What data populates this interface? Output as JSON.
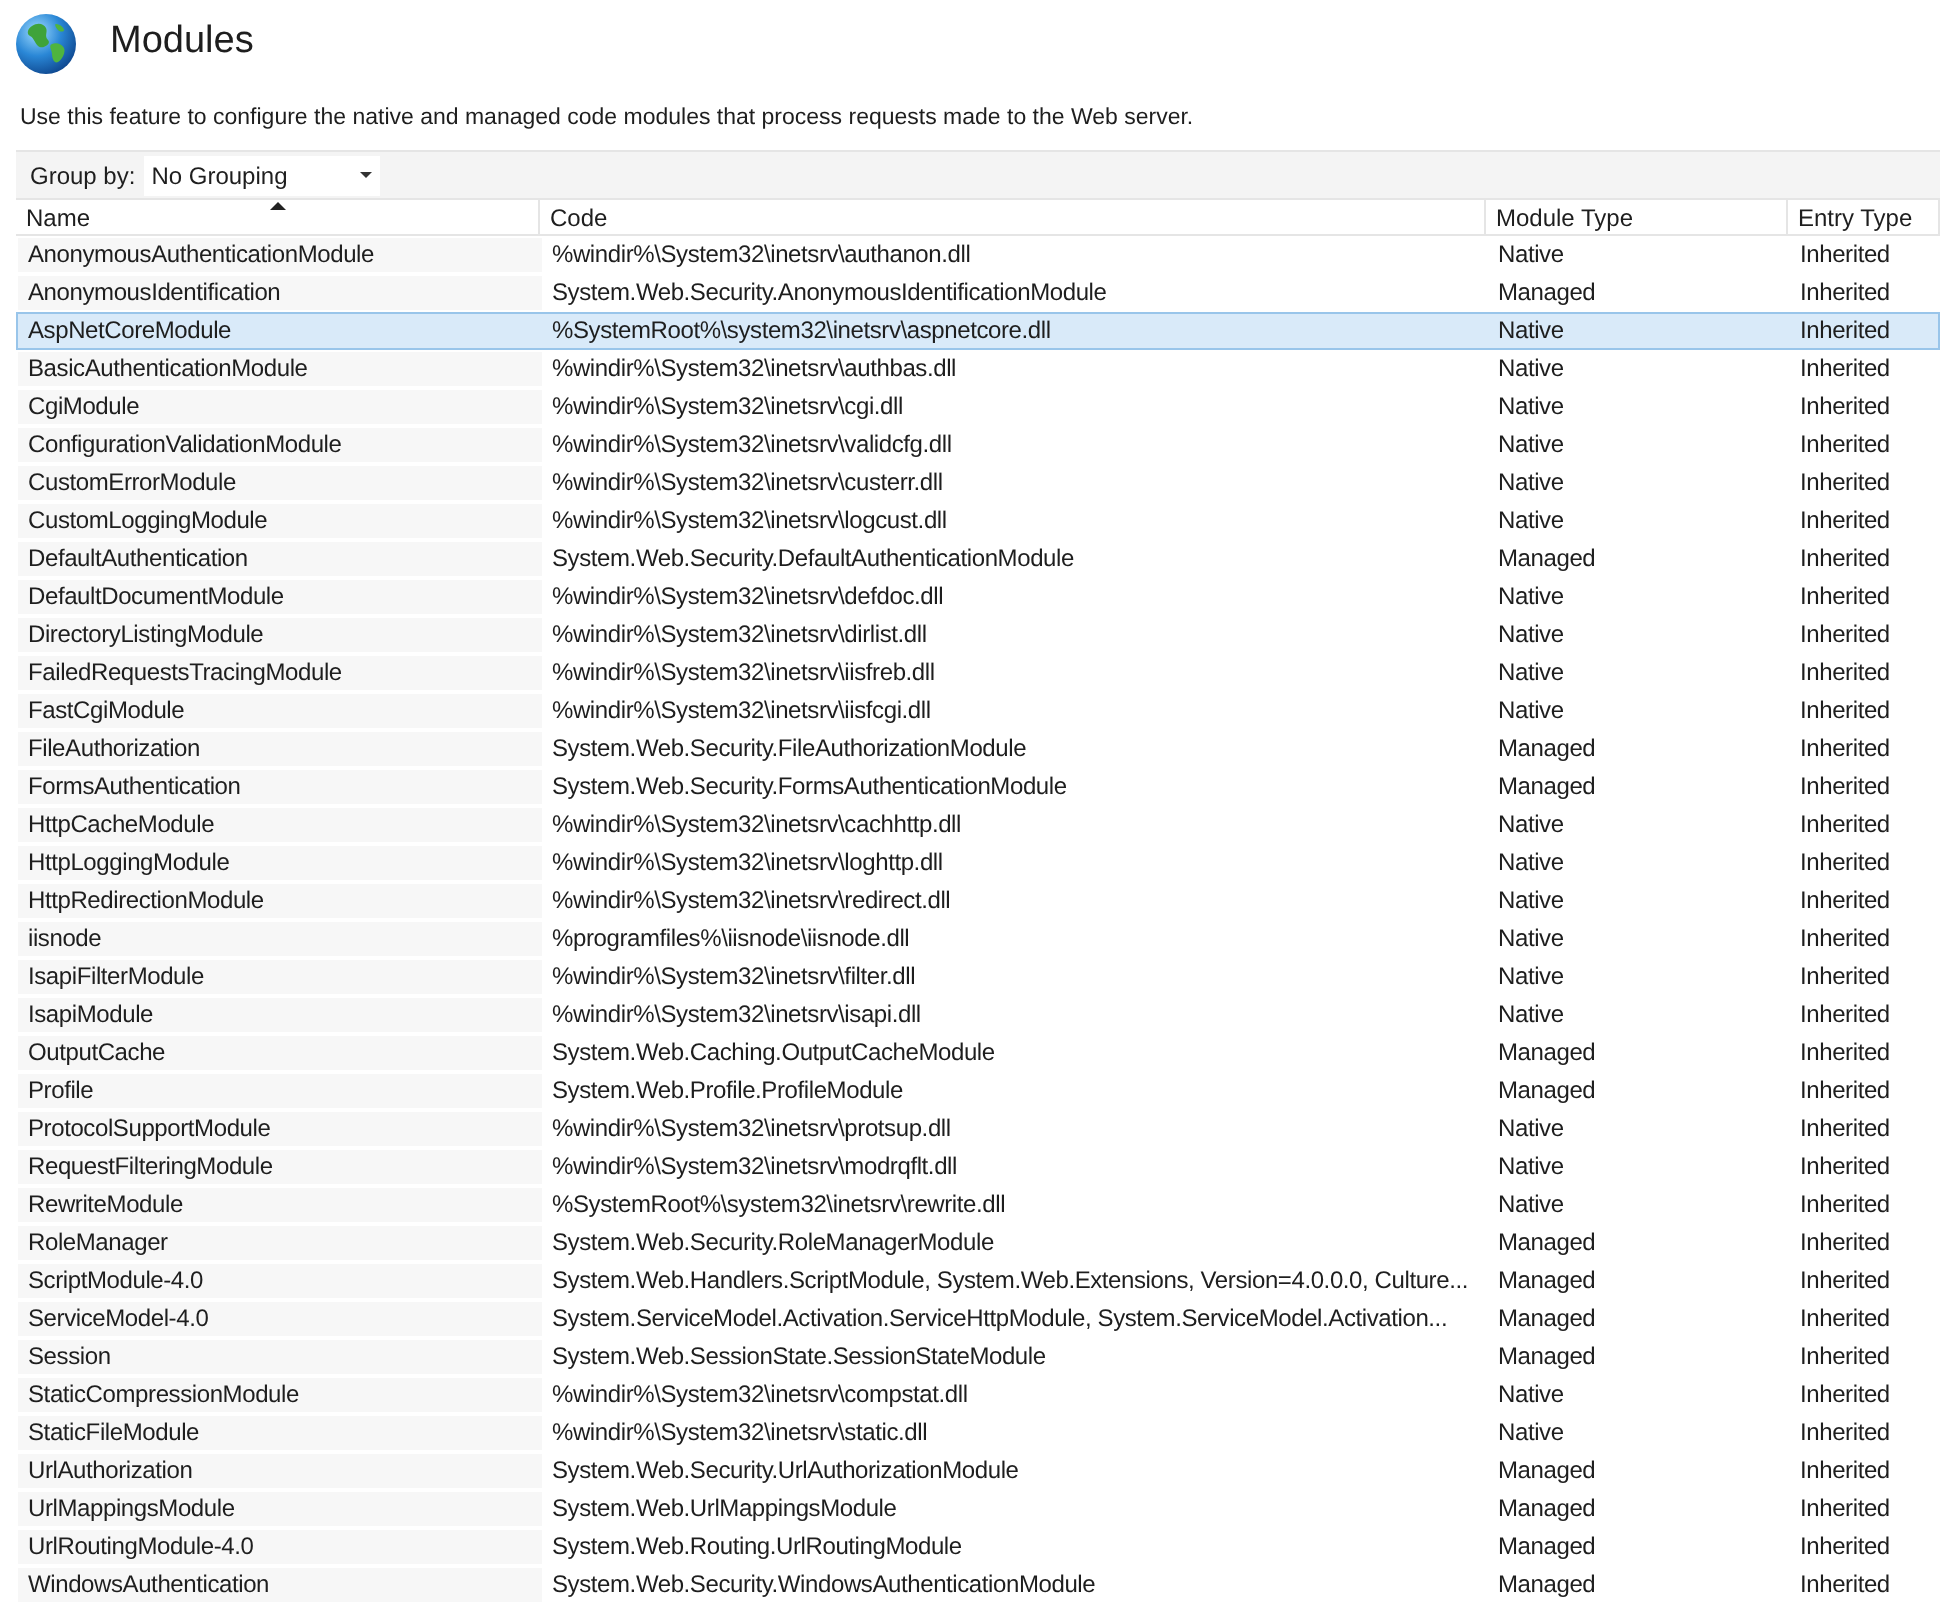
{
  "title": "Modules",
  "description": "Use this feature to configure the native and managed code modules that process requests made to the Web server.",
  "group_by": {
    "label": "Group by:",
    "value": "No Grouping"
  },
  "table": {
    "columns": [
      {
        "label": "Name",
        "sorted": true
      },
      {
        "label": "Code",
        "sorted": false
      },
      {
        "label": "Module Type",
        "sorted": false
      },
      {
        "label": "Entry Type",
        "sorted": false
      }
    ],
    "rows": [
      {
        "name": "AnonymousAuthenticationModule",
        "code": "%windir%\\System32\\inetsrv\\authanon.dll",
        "module_type": "Native",
        "entry_type": "Inherited",
        "selected": false
      },
      {
        "name": "AnonymousIdentification",
        "code": "System.Web.Security.AnonymousIdentificationModule",
        "module_type": "Managed",
        "entry_type": "Inherited",
        "selected": false
      },
      {
        "name": "AspNetCoreModule",
        "code": "%SystemRoot%\\system32\\inetsrv\\aspnetcore.dll",
        "module_type": "Native",
        "entry_type": "Inherited",
        "selected": true
      },
      {
        "name": "BasicAuthenticationModule",
        "code": "%windir%\\System32\\inetsrv\\authbas.dll",
        "module_type": "Native",
        "entry_type": "Inherited",
        "selected": false
      },
      {
        "name": "CgiModule",
        "code": "%windir%\\System32\\inetsrv\\cgi.dll",
        "module_type": "Native",
        "entry_type": "Inherited",
        "selected": false
      },
      {
        "name": "ConfigurationValidationModule",
        "code": "%windir%\\System32\\inetsrv\\validcfg.dll",
        "module_type": "Native",
        "entry_type": "Inherited",
        "selected": false
      },
      {
        "name": "CustomErrorModule",
        "code": "%windir%\\System32\\inetsrv\\custerr.dll",
        "module_type": "Native",
        "entry_type": "Inherited",
        "selected": false
      },
      {
        "name": "CustomLoggingModule",
        "code": "%windir%\\System32\\inetsrv\\logcust.dll",
        "module_type": "Native",
        "entry_type": "Inherited",
        "selected": false
      },
      {
        "name": "DefaultAuthentication",
        "code": "System.Web.Security.DefaultAuthenticationModule",
        "module_type": "Managed",
        "entry_type": "Inherited",
        "selected": false
      },
      {
        "name": "DefaultDocumentModule",
        "code": "%windir%\\System32\\inetsrv\\defdoc.dll",
        "module_type": "Native",
        "entry_type": "Inherited",
        "selected": false
      },
      {
        "name": "DirectoryListingModule",
        "code": "%windir%\\System32\\inetsrv\\dirlist.dll",
        "module_type": "Native",
        "entry_type": "Inherited",
        "selected": false
      },
      {
        "name": "FailedRequestsTracingModule",
        "code": "%windir%\\System32\\inetsrv\\iisfreb.dll",
        "module_type": "Native",
        "entry_type": "Inherited",
        "selected": false
      },
      {
        "name": "FastCgiModule",
        "code": "%windir%\\System32\\inetsrv\\iisfcgi.dll",
        "module_type": "Native",
        "entry_type": "Inherited",
        "selected": false
      },
      {
        "name": "FileAuthorization",
        "code": "System.Web.Security.FileAuthorizationModule",
        "module_type": "Managed",
        "entry_type": "Inherited",
        "selected": false
      },
      {
        "name": "FormsAuthentication",
        "code": "System.Web.Security.FormsAuthenticationModule",
        "module_type": "Managed",
        "entry_type": "Inherited",
        "selected": false
      },
      {
        "name": "HttpCacheModule",
        "code": "%windir%\\System32\\inetsrv\\cachhttp.dll",
        "module_type": "Native",
        "entry_type": "Inherited",
        "selected": false
      },
      {
        "name": "HttpLoggingModule",
        "code": "%windir%\\System32\\inetsrv\\loghttp.dll",
        "module_type": "Native",
        "entry_type": "Inherited",
        "selected": false
      },
      {
        "name": "HttpRedirectionModule",
        "code": "%windir%\\System32\\inetsrv\\redirect.dll",
        "module_type": "Native",
        "entry_type": "Inherited",
        "selected": false
      },
      {
        "name": "iisnode",
        "code": "%programfiles%\\iisnode\\iisnode.dll",
        "module_type": "Native",
        "entry_type": "Inherited",
        "selected": false
      },
      {
        "name": "IsapiFilterModule",
        "code": "%windir%\\System32\\inetsrv\\filter.dll",
        "module_type": "Native",
        "entry_type": "Inherited",
        "selected": false
      },
      {
        "name": "IsapiModule",
        "code": "%windir%\\System32\\inetsrv\\isapi.dll",
        "module_type": "Native",
        "entry_type": "Inherited",
        "selected": false
      },
      {
        "name": "OutputCache",
        "code": "System.Web.Caching.OutputCacheModule",
        "module_type": "Managed",
        "entry_type": "Inherited",
        "selected": false
      },
      {
        "name": "Profile",
        "code": "System.Web.Profile.ProfileModule",
        "module_type": "Managed",
        "entry_type": "Inherited",
        "selected": false
      },
      {
        "name": "ProtocolSupportModule",
        "code": "%windir%\\System32\\inetsrv\\protsup.dll",
        "module_type": "Native",
        "entry_type": "Inherited",
        "selected": false
      },
      {
        "name": "RequestFilteringModule",
        "code": "%windir%\\System32\\inetsrv\\modrqflt.dll",
        "module_type": "Native",
        "entry_type": "Inherited",
        "selected": false
      },
      {
        "name": "RewriteModule",
        "code": "%SystemRoot%\\system32\\inetsrv\\rewrite.dll",
        "module_type": "Native",
        "entry_type": "Inherited",
        "selected": false
      },
      {
        "name": "RoleManager",
        "code": "System.Web.Security.RoleManagerModule",
        "module_type": "Managed",
        "entry_type": "Inherited",
        "selected": false
      },
      {
        "name": "ScriptModule-4.0",
        "code": "System.Web.Handlers.ScriptModule, System.Web.Extensions, Version=4.0.0.0, Culture...",
        "module_type": "Managed",
        "entry_type": "Inherited",
        "selected": false
      },
      {
        "name": "ServiceModel-4.0",
        "code": "System.ServiceModel.Activation.ServiceHttpModule, System.ServiceModel.Activation...",
        "module_type": "Managed",
        "entry_type": "Inherited",
        "selected": false
      },
      {
        "name": "Session",
        "code": "System.Web.SessionState.SessionStateModule",
        "module_type": "Managed",
        "entry_type": "Inherited",
        "selected": false
      },
      {
        "name": "StaticCompressionModule",
        "code": "%windir%\\System32\\inetsrv\\compstat.dll",
        "module_type": "Native",
        "entry_type": "Inherited",
        "selected": false
      },
      {
        "name": "StaticFileModule",
        "code": "%windir%\\System32\\inetsrv\\static.dll",
        "module_type": "Native",
        "entry_type": "Inherited",
        "selected": false
      },
      {
        "name": "UrlAuthorization",
        "code": "System.Web.Security.UrlAuthorizationModule",
        "module_type": "Managed",
        "entry_type": "Inherited",
        "selected": false
      },
      {
        "name": "UrlMappingsModule",
        "code": "System.Web.UrlMappingsModule",
        "module_type": "Managed",
        "entry_type": "Inherited",
        "selected": false
      },
      {
        "name": "UrlRoutingModule-4.0",
        "code": "System.Web.Routing.UrlRoutingModule",
        "module_type": "Managed",
        "entry_type": "Inherited",
        "selected": false
      },
      {
        "name": "WindowsAuthentication",
        "code": "System.Web.Security.WindowsAuthenticationModule",
        "module_type": "Managed",
        "entry_type": "Inherited",
        "selected": false
      }
    ]
  }
}
